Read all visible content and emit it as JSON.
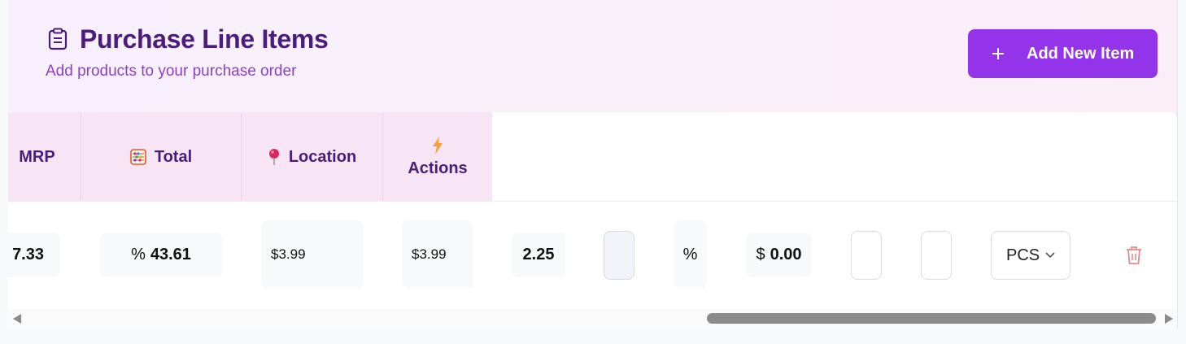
{
  "header": {
    "title": "Purchase Line Items",
    "subtitle": "Add products to your purchase order",
    "add_button_label": "Add New Item",
    "accent_color": "#9333ea",
    "title_color": "#4a1d7a"
  },
  "table": {
    "columns": [
      {
        "label": "MRP",
        "icon": null
      },
      {
        "label": "Total",
        "icon": "abacus-icon"
      },
      {
        "label": "Location",
        "icon": "pushpin-icon"
      },
      {
        "label": "Actions",
        "icon": "lightning-icon"
      }
    ],
    "row": {
      "mrp": "7.33",
      "total_prefix": "%",
      "total_value": "43.61",
      "location_price_1": "$3.99",
      "location_price_2": "$3.99",
      "qty": "2.25",
      "discount_symbol": "%",
      "amount_prefix": "$",
      "amount_value": "0.00",
      "unit": "PCS"
    }
  },
  "scrollbar": {
    "position": 0.62
  }
}
